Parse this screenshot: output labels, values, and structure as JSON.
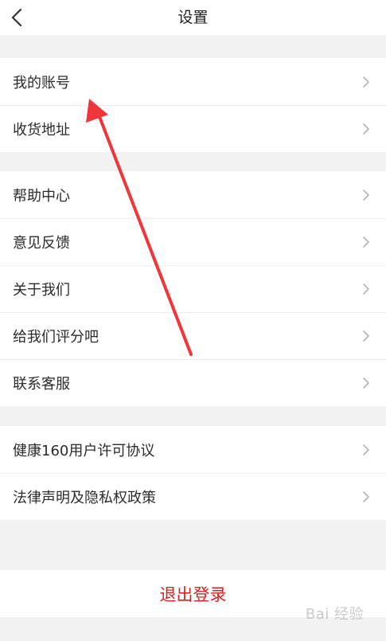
{
  "navbar": {
    "title": "设置"
  },
  "groups": [
    {
      "items": [
        {
          "label": "我的账号"
        },
        {
          "label": "收货地址"
        }
      ]
    },
    {
      "items": [
        {
          "label": "帮助中心"
        },
        {
          "label": "意见反馈"
        },
        {
          "label": "关于我们"
        },
        {
          "label": "给我们评分吧"
        },
        {
          "label": "联系客服"
        }
      ]
    },
    {
      "items": [
        {
          "label": "健康160用户许可协议"
        },
        {
          "label": "法律声明及隐私权政策"
        }
      ]
    }
  ],
  "logout": {
    "label": "退出登录"
  },
  "watermark": {
    "text": "Bai 经验"
  },
  "colors": {
    "logout_text": "#d9201f",
    "annotation_arrow": "#f0363b"
  },
  "icons": {
    "back": "chevron-left-icon",
    "row_arrow": "chevron-right-icon"
  }
}
